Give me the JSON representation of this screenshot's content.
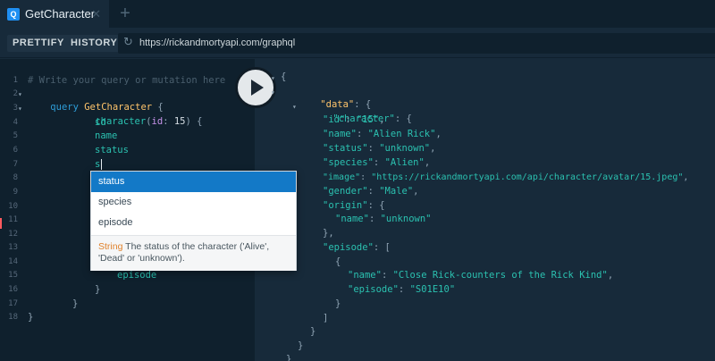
{
  "tab": {
    "icon_label": "Q",
    "title": "GetCharacter",
    "close": "✕",
    "add": "+"
  },
  "toolbar": {
    "prettify": "PRETTIFY",
    "history": "HISTORY",
    "url": "https://rickandmortyapi.com/graphql"
  },
  "query": {
    "lines": [
      {
        "n": "1",
        "text": "# Write your query or mutation here"
      },
      {
        "n": "2",
        "text": "query GetCharacter {"
      },
      {
        "n": "3",
        "text": "character(id: 15) {"
      },
      {
        "n": "4",
        "text": "id"
      },
      {
        "n": "5",
        "text": "name"
      },
      {
        "n": "6",
        "text": "status"
      },
      {
        "n": "7",
        "text": "s"
      },
      {
        "n": "8",
        "text": ""
      },
      {
        "n": "9",
        "text": ""
      },
      {
        "n": "10",
        "text": ""
      },
      {
        "n": "11",
        "text": ""
      },
      {
        "n": "12",
        "text": ""
      },
      {
        "n": "13",
        "text": ""
      },
      {
        "n": "14",
        "text": ""
      },
      {
        "n": "15",
        "text": ""
      },
      {
        "n": "16",
        "text": "episode"
      },
      {
        "n": "17",
        "text": "}"
      },
      {
        "n": "18",
        "text": "}"
      }
    ]
  },
  "autocomplete": {
    "items": [
      "status",
      "species",
      "episode"
    ],
    "desc_type": "String",
    "desc_text": "The status of the character ('Alive', 'Dead' or 'unknown')."
  },
  "result": {
    "data_key": "\"data\"",
    "character_key": "\"character\"",
    "fields": [
      {
        "k": "\"id\"",
        "v": "\"15\""
      },
      {
        "k": "\"name\"",
        "v": "\"Alien Rick\""
      },
      {
        "k": "\"status\"",
        "v": "\"unknown\""
      },
      {
        "k": "\"species\"",
        "v": "\"Alien\""
      },
      {
        "k": "\"image\"",
        "v": "\"https://rickandmortyapi.com/api/character/avatar/15.jpeg\""
      },
      {
        "k": "\"gender\"",
        "v": "\"Male\""
      }
    ],
    "origin_key": "\"origin\"",
    "origin_name_key": "\"name\"",
    "origin_name_val": "\"unknown\"",
    "episode_key": "\"episode\"",
    "ep_name_key": "\"name\"",
    "ep_name_val": "\"Close Rick-counters of the Rick Kind\"",
    "ep_code_key": "\"episode\"",
    "ep_code_val": "\"S01E10\""
  }
}
